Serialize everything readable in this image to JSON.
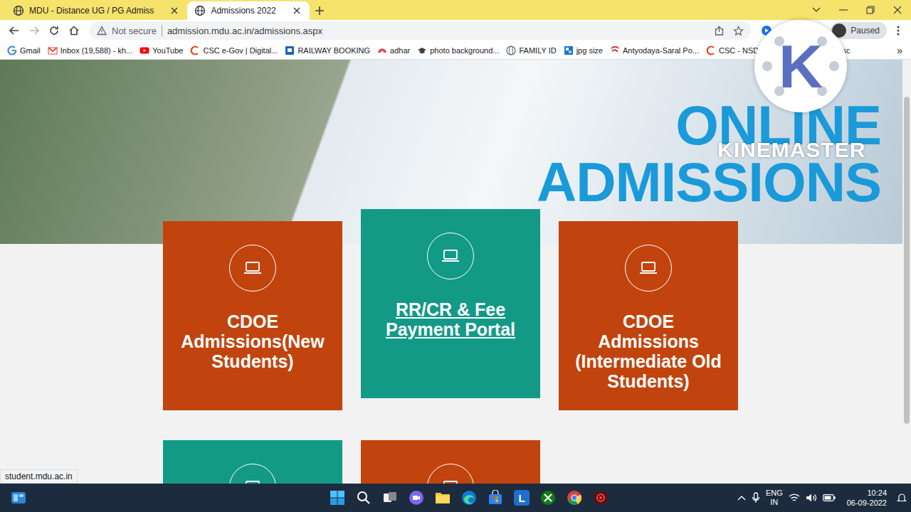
{
  "browser": {
    "tabs": [
      {
        "title": "MDU - Distance UG / PG Admiss",
        "selected": false
      },
      {
        "title": "Admissions 2022",
        "selected": true
      }
    ],
    "address_bar": {
      "security": "Not secure",
      "url": "admission.mdu.ac.in/admissions.aspx"
    },
    "profile": {
      "status": "Paused"
    },
    "bookmarks": [
      "Gmail",
      "Inbox (19,588) - kh...",
      "YouTube",
      "CSC e-Gov | Digital...",
      "RAILWAY BOOKING",
      "adhar",
      "photo background...",
      "FAMILY ID",
      "jpg size",
      "Antyodaya-Saral Po...",
      "CSC - NSDL Pan Se",
      "sc",
      "ssc"
    ],
    "bookmarks_more": "»"
  },
  "page": {
    "banner": {
      "title_line1": "ONLINE",
      "title_line2": "ADMISSIONS"
    },
    "cards": [
      {
        "title": "CDOE Admissions(New Students)",
        "color": "#c1440e",
        "hovered": false
      },
      {
        "title": "RR/CR & Fee Payment Portal",
        "color": "#129a87",
        "hovered": true
      },
      {
        "title": "CDOE Admissions (Intermediate Old Students)",
        "color": "#c1440e",
        "hovered": false
      }
    ],
    "more_cards": [
      {
        "color": "#129a87"
      },
      {
        "color": "#c1440e"
      }
    ],
    "status_url": "student.mdu.ac.in"
  },
  "watermark": {
    "logo_letter": "K",
    "text": "KINEMASTER"
  },
  "taskbar": {
    "pinned_letter": "L",
    "language": "ENG",
    "region": "IN",
    "time": "10:24",
    "date": "06-09-2022"
  }
}
